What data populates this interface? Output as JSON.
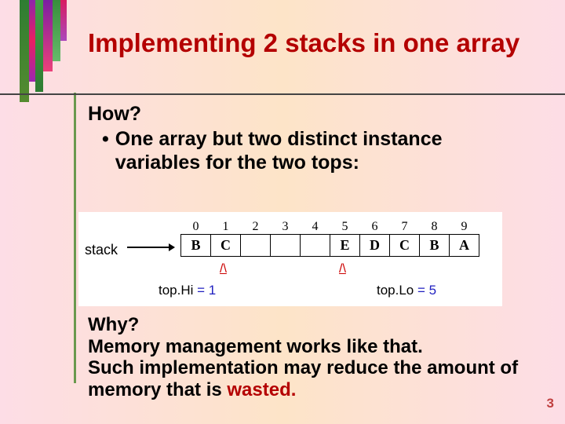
{
  "title": "Implementing 2 stacks in one array",
  "how": "How?",
  "bullet": "One array but two distinct instance variables for the two tops:",
  "diagram": {
    "indices": [
      "0",
      "1",
      "2",
      "3",
      "4",
      "5",
      "6",
      "7",
      "8",
      "9"
    ],
    "cells": [
      "B",
      "C",
      "",
      "",
      "",
      "E",
      "D",
      "C",
      "B",
      "A"
    ],
    "stackLabel": "stack",
    "caret": "/\\",
    "topHi": "top.Hi",
    "topHiVal": " = 1",
    "topLo": "top.Lo",
    "topLoVal": " = 5"
  },
  "why": "Why?",
  "why1": "Memory management works like that.",
  "why2": "Such implementation may reduce the amount of  memory that is wasted.",
  "pageNum": "3"
}
